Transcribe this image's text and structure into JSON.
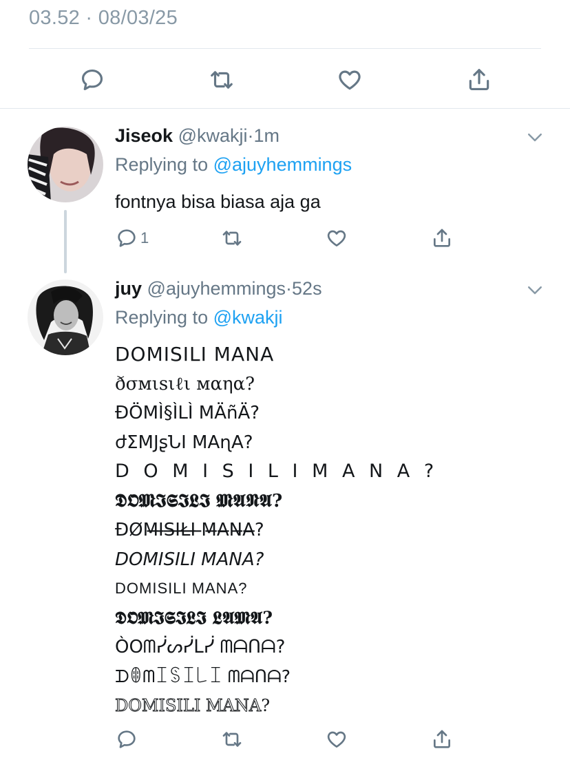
{
  "main_tweet": {
    "timestamp": "03.52 · 08/03/25",
    "actions": {
      "reply_icon": "reply-icon",
      "retweet_icon": "retweet-icon",
      "like_icon": "heart-icon",
      "share_icon": "share-icon"
    }
  },
  "replies": [
    {
      "name": "Jiseok",
      "handle": "@kwakji",
      "separator": "·",
      "time": "1m",
      "replying_prefix": "Replying to",
      "replying_to": "@ajuyhemmings",
      "text": "fontnya bisa biasa aja ga",
      "reply_count": "1"
    },
    {
      "name": "juy",
      "handle": "@ajuyhemmings",
      "separator": "·",
      "time": "52s",
      "replying_prefix": "Replying to",
      "replying_to": "@kwakji",
      "font_lines": [
        "DOMISILI MANA",
        "ðσмιѕιℓι мαηα?",
        "ĐÖMÌ§ÌLÌ MÄñÄ?",
        "ժΣMJʂՆI MAɳA?",
        "D O M I S I L I  M A N A ?",
        "𝕯𝕺𝕸𝕴𝕾𝕴𝕷𝕴 𝕸𝕬𝕹𝕬?",
        "ĐØM̶I̶S̶I̶Ł̶I̶ ̶M̶A̶N̶A̶?",
        "DOMISILI MANA?",
        "DOMISILI MANA?",
        "𝕯𝕺𝕸𝕴𝕾𝕴𝕷𝕴 𝕷𝕬𝕸𝕬?",
        "ÒOᗰᓰᔕᓰᒪᓰ ᗰᗩᑎᗩ?",
        "ᗪꂦᗰꀤꌗꀤ꒒ꀤ ᗰᗩᑎᗩ?",
        "DOMISILI MANA",
        "?"
      ]
    }
  ]
}
